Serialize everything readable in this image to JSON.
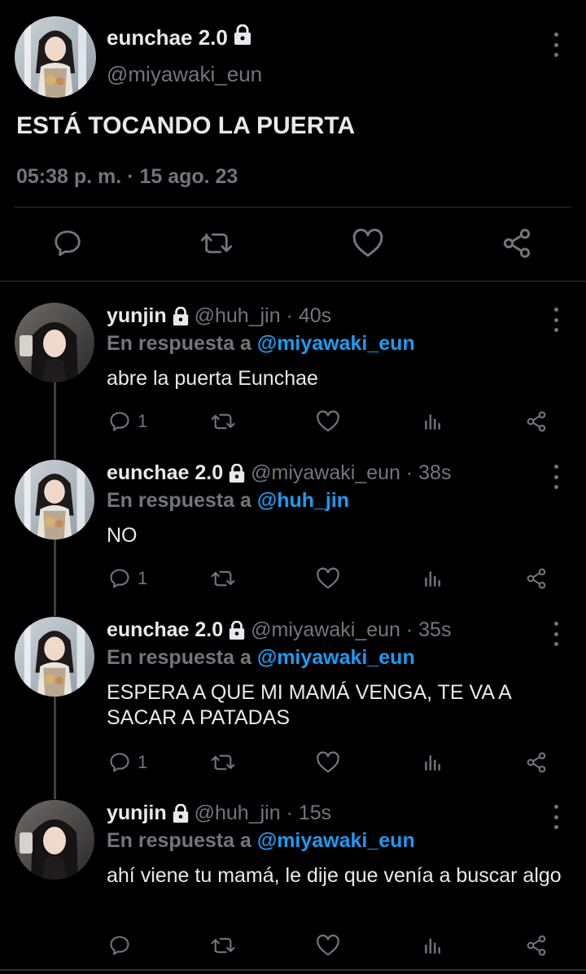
{
  "colors": {
    "background": "#000000",
    "text": "#e7e9ea",
    "muted": "#71767b",
    "accent": "#1d9bf0",
    "divider": "#2f3336"
  },
  "main": {
    "name": "eunchae 2.0",
    "handle": "@miyawaki_eun",
    "text": "ESTÁ TOCANDO LA PUERTA",
    "time": "05:38 p. m. · 15 ago. 23",
    "actions": [
      "reply-icon",
      "retweet-icon",
      "like-icon",
      "share-icon"
    ]
  },
  "replies": [
    {
      "name": "yunjin",
      "handle": "@huh_jin · 40s",
      "in_reply_prefix": "En respuesta a ",
      "in_reply_to": "@miyawaki_eun",
      "text": "abre la puerta Eunchae",
      "reply_count": "1"
    },
    {
      "name": "eunchae 2.0",
      "handle": "@miyawaki_eun · 38s",
      "in_reply_prefix": "En respuesta a ",
      "in_reply_to": "@huh_jin",
      "text": "NO",
      "reply_count": "1"
    },
    {
      "name": "eunchae 2.0",
      "handle": "@miyawaki_eun · 35s",
      "in_reply_prefix": "En respuesta a ",
      "in_reply_to": "@miyawaki_eun",
      "text": "ESPERA A QUE MI MAMÁ VENGA, TE VA A SACAR A PATADAS",
      "reply_count": "1"
    },
    {
      "name": "yunjin",
      "handle": "@huh_jin · 15s",
      "in_reply_prefix": "En respuesta a ",
      "in_reply_to": "@miyawaki_eun",
      "text": "ahí viene tu mamá, le dije que venía a buscar algo",
      "reply_count": ""
    }
  ]
}
